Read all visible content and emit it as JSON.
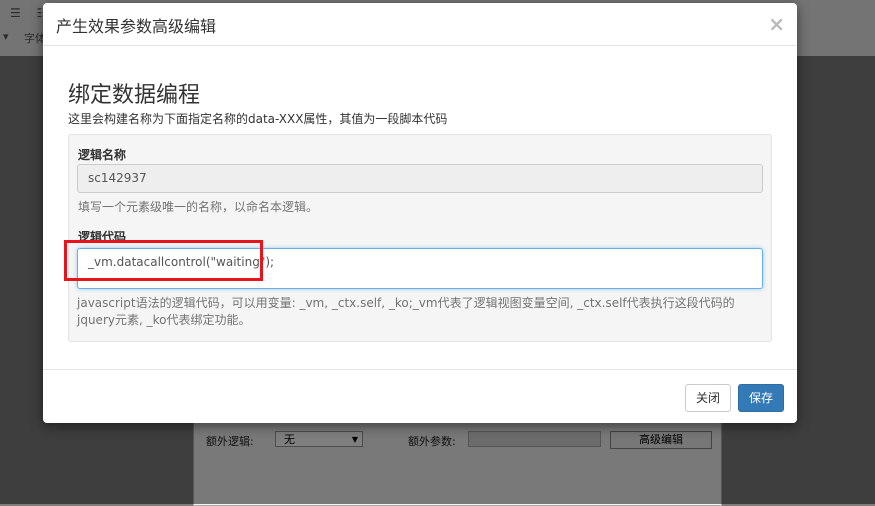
{
  "background": {
    "toolbar": {
      "row1_icons": "☰ ☷",
      "font_label": "字体"
    },
    "panel": {
      "extra_logic_label": "额外逻辑:",
      "extra_logic_value": "无",
      "extra_params_label": "额外参数:",
      "advanced_edit_label": "高级编辑"
    }
  },
  "modal": {
    "title": "产生效果参数高级编辑",
    "close_glyph": "×",
    "section_title": "绑定数据编程",
    "section_desc": "这里会构建名称为下面指定名称的data-XXX属性，其值为一段脚本代码",
    "logic_name_label": "逻辑名称",
    "logic_name_value": "sc142937",
    "logic_name_help": "填写一个元素级唯一的名称，以命名本逻辑。",
    "logic_code_label": "逻辑代码",
    "logic_code_value": "_vm.datacallcontrol(\"waiting\");",
    "logic_code_help": "javascript语法的逻辑代码，可以用变量: _vm, _ctx.self, _ko;_vm代表了逻辑视图变量空间, _ctx.self代表执行这段代码的jquery元素, _ko代表绑定功能。",
    "close_button": "关闭",
    "save_button": "保存"
  },
  "colors": {
    "primary": "#337ab7",
    "highlight": "#e8141c"
  }
}
